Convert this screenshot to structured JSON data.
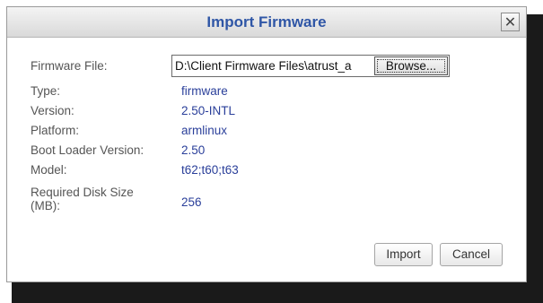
{
  "dialog": {
    "title": "Import Firmware",
    "close_glyph": "✕",
    "firmware_file": {
      "label": "Firmware File:",
      "value": "D:\\Client Firmware Files\\atrust_a",
      "browse_label": "Browse..."
    },
    "fields": [
      {
        "label": "Type:",
        "value": "firmware"
      },
      {
        "label": "Version:",
        "value": "2.50-INTL"
      },
      {
        "label": "Platform:",
        "value": "armlinux"
      },
      {
        "label": "Boot Loader Version:",
        "value": "2.50"
      },
      {
        "label": "Model:",
        "value": "t62;t60;t63"
      },
      {
        "label": "Required Disk Size (MB):",
        "value": "256"
      }
    ],
    "buttons": {
      "import_label": "Import",
      "cancel_label": "Cancel"
    }
  },
  "colors": {
    "title": "#2f56a6",
    "value": "#2a3f9a",
    "label": "#555555"
  }
}
